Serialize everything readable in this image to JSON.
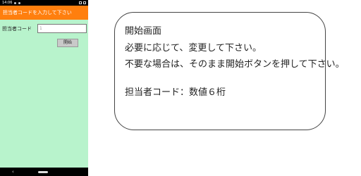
{
  "status_bar": {
    "time": "14:06"
  },
  "app_bar": {
    "title": "担当者コードを入力して下さい"
  },
  "form": {
    "label": "担当者コード",
    "field_value": "1",
    "start_label": "開始"
  },
  "info": {
    "title": "開始画面",
    "line1": "必要に応じて、変更して下さい。",
    "line2": "不要な場合は、そのまま開始ボタンを押して下さい。",
    "line3": "担当者コード：数値６桁"
  },
  "nav": {
    "back": "‹"
  },
  "colors": {
    "phone_bg": "#b8f3cc",
    "app_bar": "#ff7f0e"
  }
}
